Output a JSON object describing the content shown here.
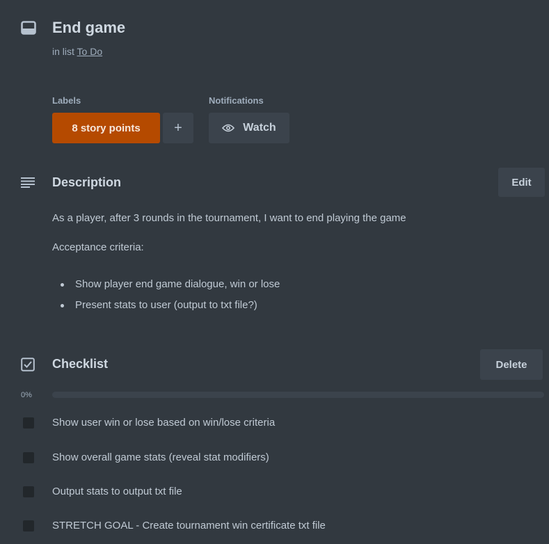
{
  "card": {
    "title": "End game",
    "in_list_prefix": "in list",
    "list_name": "To Do"
  },
  "labels": {
    "heading": "Labels",
    "items": [
      "8 story points"
    ],
    "add_symbol": "+",
    "label_color": "#b54a00"
  },
  "notifications": {
    "heading": "Notifications",
    "watch_label": "Watch"
  },
  "description": {
    "heading": "Description",
    "edit_label": "Edit",
    "paragraph": "As a player, after 3 rounds in the tournament, I want to end playing the game",
    "criteria_heading": "Acceptance criteria:",
    "bullets": [
      "Show player end game dialogue, win or lose",
      "Present stats to user (output to txt file?)"
    ]
  },
  "checklist": {
    "heading": "Checklist",
    "delete_label": "Delete",
    "progress_text": "0%",
    "progress_fraction": 0,
    "items": [
      {
        "text": "Show user win or lose based on win/lose criteria",
        "checked": false
      },
      {
        "text": "Show overall game stats (reveal stat modifiers)",
        "checked": false
      },
      {
        "text": "Output stats to output txt file",
        "checked": false
      },
      {
        "text": "STRETCH GOAL - Create tournament win certificate txt file",
        "checked": false
      }
    ]
  },
  "icons": {
    "card": "card-icon",
    "description": "description-lines-icon",
    "checklist": "checklist-icon",
    "watch": "eye-icon"
  },
  "colors": {
    "background": "#323940",
    "button": "#3b434c",
    "text": "#b6c2cf"
  }
}
